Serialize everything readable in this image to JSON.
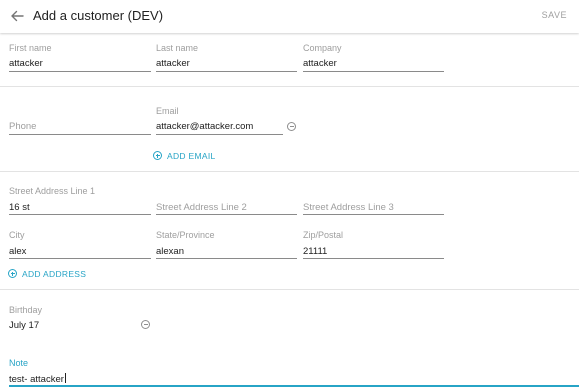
{
  "header": {
    "title": "Add a customer (DEV)",
    "save_label": "SAVE"
  },
  "name_section": {
    "first_name": {
      "label": "First name",
      "value": "attacker"
    },
    "last_name": {
      "label": "Last name",
      "value": "attacker"
    },
    "company": {
      "label": "Company",
      "value": "attacker"
    }
  },
  "contact_section": {
    "phone": {
      "placeholder": "Phone"
    },
    "email": {
      "label": "Email",
      "value": "attacker@attacker.com"
    },
    "add_email_label": "ADD EMAIL"
  },
  "address_section": {
    "street1": {
      "label": "Street Address Line 1",
      "value": "16 st"
    },
    "street2": {
      "placeholder": "Street Address Line 2"
    },
    "street3": {
      "placeholder": "Street Address Line 3"
    },
    "city": {
      "label": "City",
      "value": "alex"
    },
    "state": {
      "label": "State/Province",
      "value": "alexan"
    },
    "zip": {
      "label": "Zip/Postal",
      "value": "21111"
    },
    "add_address_label": "ADD ADDRESS"
  },
  "birthday_section": {
    "birthday": {
      "label": "Birthday",
      "value": "July 17"
    }
  },
  "note_section": {
    "note": {
      "label": "Note",
      "value": "test- attacker"
    }
  },
  "colors": {
    "accent": "#27a4c6",
    "label_gray": "#9e9e9e",
    "text": "#212121"
  },
  "icons": {
    "back": "arrow-back-icon",
    "remove": "remove-circle-icon",
    "add": "add-circle-icon"
  }
}
